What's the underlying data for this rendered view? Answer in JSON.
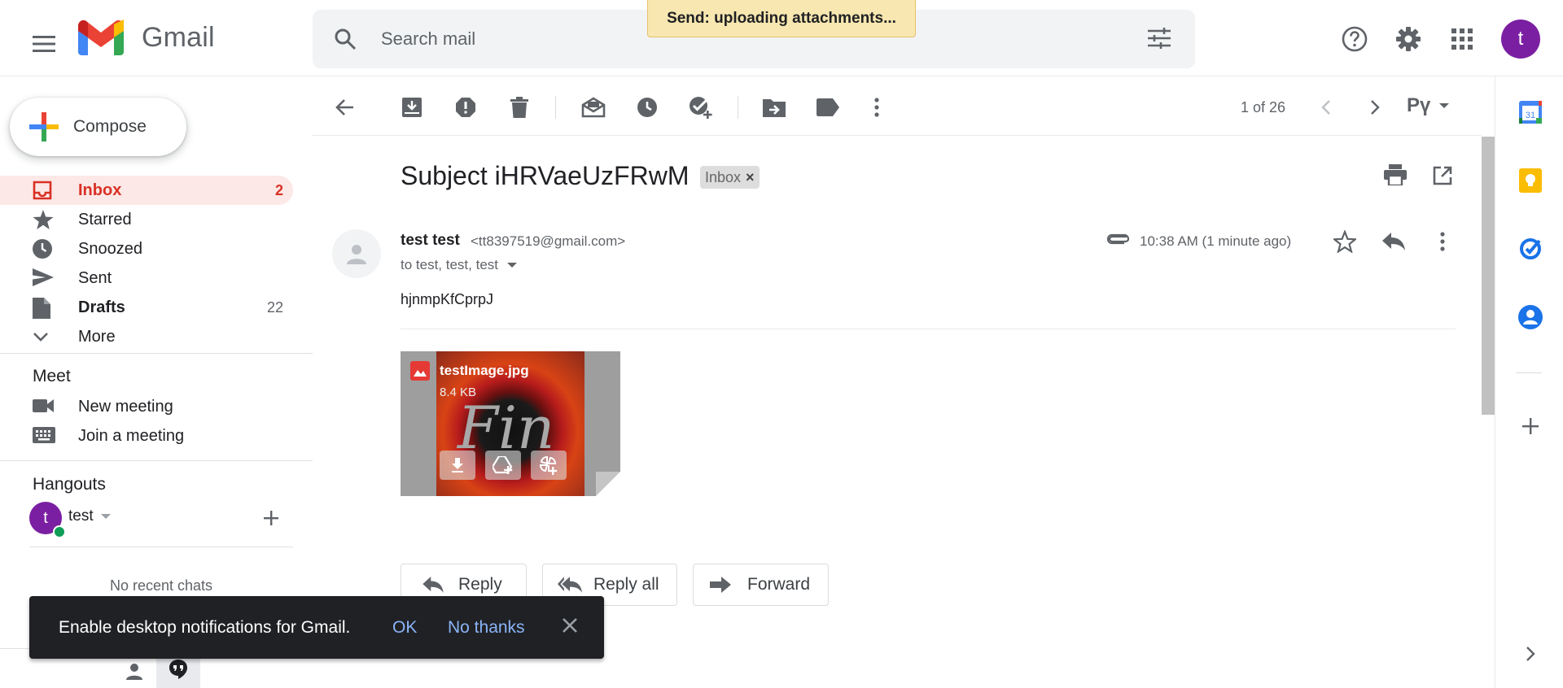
{
  "header": {
    "app_name": "Gmail",
    "search_placeholder": "Search mail",
    "upload_toast": "Send: uploading attachments...",
    "avatar_letter": "t"
  },
  "sidebar": {
    "compose_label": "Compose",
    "items": [
      {
        "label": "Inbox",
        "count": "2"
      },
      {
        "label": "Starred",
        "count": ""
      },
      {
        "label": "Snoozed",
        "count": ""
      },
      {
        "label": "Sent",
        "count": ""
      },
      {
        "label": "Drafts",
        "count": "22"
      },
      {
        "label": "More",
        "count": ""
      }
    ],
    "meet": {
      "title": "Meet",
      "new_meeting": "New meeting",
      "join_meeting": "Join a meeting"
    },
    "hangouts": {
      "title": "Hangouts",
      "user": "test",
      "user_letter": "t",
      "no_chats": "No recent chats"
    }
  },
  "toolbar": {
    "pagination": "1 of 26",
    "input_tool": "Рү"
  },
  "email": {
    "subject": "Subject iHRVaeUzFRwM",
    "label_chip": "Inbox",
    "label_chip_close": "×",
    "sender_name": "test test",
    "sender_email": "<tt8397519@gmail.com>",
    "to_line": "to test, test, test",
    "time": "10:38 AM (1 minute ago)",
    "body": "hjnmpKfCprpJ",
    "attachment": {
      "name": "testImage.jpg",
      "size": "8.4 KB",
      "image_text": "Fin"
    }
  },
  "actions": {
    "reply": "Reply",
    "reply_all": "Reply all",
    "forward": "Forward"
  },
  "snackbar": {
    "text": "Enable desktop notifications for Gmail.",
    "ok": "OK",
    "no_thanks": "No thanks"
  },
  "colors": {
    "inbox_active_bg": "#fce8e6",
    "inbox_red": "#d93025",
    "avatar_purple": "#7b1fa2",
    "toast_yellow": "#f8e7b0"
  }
}
